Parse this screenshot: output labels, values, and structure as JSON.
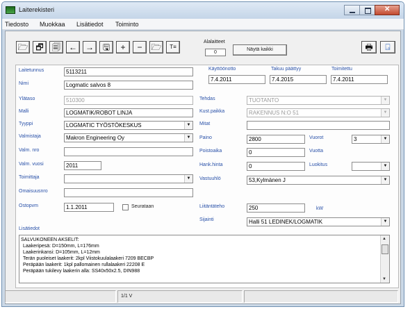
{
  "window": {
    "title": "Laiterekisteri"
  },
  "menu": [
    "Tiedosto",
    "Muokkaa",
    "Lisätiedot",
    "Toiminto"
  ],
  "toolbar": {
    "buttons": [
      {
        "name": "open-folder-icon",
        "glyph": "🗁"
      },
      {
        "name": "card-edit-icon",
        "glyph": "🗗"
      },
      {
        "name": "card-copy-icon",
        "glyph": "🗐"
      },
      {
        "name": "prev-arrow-icon",
        "glyph": "←"
      },
      {
        "name": "next-arrow-icon",
        "glyph": "→"
      },
      {
        "name": "save-disk-icon",
        "glyph": "🖫"
      },
      {
        "name": "add-icon",
        "glyph": "+"
      },
      {
        "name": "remove-icon",
        "glyph": "−"
      },
      {
        "name": "folder-open-icon",
        "glyph": "🗁"
      },
      {
        "name": "list-sort-icon",
        "glyph": "T≡"
      }
    ],
    "alalaitteet_label": "Alalaitteet",
    "alalaitteet_count": "0",
    "show_all_label": "Näytä kaikki",
    "print_glyph": "🖶",
    "exit_glyph": "⍈"
  },
  "form": {
    "laitetunnus": {
      "label": "Laitetunnus",
      "value": "5113211"
    },
    "nimi": {
      "label": "Nimi",
      "value": "Logmatic salvos 8"
    },
    "ylataso": {
      "label": "Ylätaso",
      "value": "510300"
    },
    "malli": {
      "label": "Malli",
      "value": "LOGMATIK/ROBOT LINJA"
    },
    "tyyppi": {
      "label": "Tyyppi",
      "value": "LOGMATIC TYÖSTÖKESKUS"
    },
    "valmistaja": {
      "label": "Valmistaja",
      "value": "Makron Engineering Oy"
    },
    "valm_nro": {
      "label": "Valm. nro",
      "value": ""
    },
    "valm_vuosi": {
      "label": "Valm. vuosi",
      "value": "2011"
    },
    "toimittaja": {
      "label": "Toimittaja",
      "value": ""
    },
    "omaisuusnro": {
      "label": "Omaisuusnro",
      "value": ""
    },
    "ostopvm": {
      "label": "Ostopvm",
      "value": "1.1.2011"
    },
    "seurataan": {
      "label": "Seurataan",
      "checked": false
    },
    "kayttoonotto": {
      "label": "Käyttöönotto",
      "value": "7.4.2011"
    },
    "takuu": {
      "label": "Takuu päättyy",
      "value": "7.4.2015"
    },
    "toimitettu": {
      "label": "Toimitettu",
      "value": "7.4.2011"
    },
    "tehdas": {
      "label": "Tehdas",
      "value": "TUOTANTO"
    },
    "kust_paikka": {
      "label": "Kust.paikka",
      "value": "RAKENNUS N:O 51"
    },
    "mitat": {
      "label": "Mitat",
      "value": ""
    },
    "paino": {
      "label": "Paino",
      "value": "2800"
    },
    "vuorot": {
      "label": "Vuorot",
      "value": "3"
    },
    "poistoaika": {
      "label": "Poistoaika",
      "value": "0"
    },
    "vuotta": {
      "label": "Vuotta"
    },
    "hank_hinta": {
      "label": "Hank.hinta",
      "value": "0"
    },
    "luokitus": {
      "label": "Luokitus",
      "value": ""
    },
    "vastuuhlo": {
      "label": "Vastuuhlö",
      "value": "53,Kylmänen J"
    },
    "liitantateho": {
      "label": "Liitäntäteho",
      "value": "250",
      "unit": "kW"
    },
    "sijainti": {
      "label": "Sijainti",
      "value": "Halli 51 LEDINEK/LOGMATIK"
    },
    "lisatiedot": {
      "label": "Lisätiedot",
      "lines": [
        "SALVUKONEEN AKSELIT:",
        "Laakeripesä: D=150mm, L=176mm",
        "Laakerinkansi: D=105mm, L=12mm",
        "Terän puoleiset laakerit: 2kpl Viistokuulalaakeri 7209 BECBP",
        "Peräpään laakerit: 1kpl pallomainen rullalaakeri 22208 E",
        "Peräpään tukilevy laakerin alla: SS40x50x2.5, DIN988"
      ]
    }
  },
  "status": {
    "left": "",
    "record": "1/1 V",
    "right": ""
  }
}
